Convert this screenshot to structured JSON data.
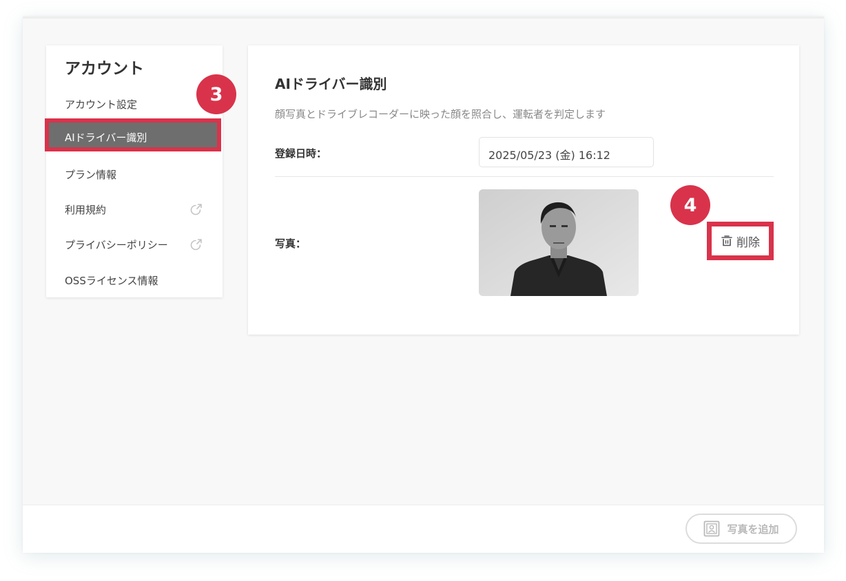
{
  "sidebar": {
    "title": "アカウント",
    "items": [
      {
        "label": "アカウント設定"
      },
      {
        "label": "AIドライバー識別"
      },
      {
        "label": "プラン情報"
      },
      {
        "label": "利用規約"
      },
      {
        "label": "プライバシーポリシー"
      },
      {
        "label": "OSSライセンス情報"
      }
    ],
    "external_icon": "external-link-icon"
  },
  "badges": {
    "sidebar_step": "3",
    "delete_step": "4"
  },
  "main": {
    "title": "AIドライバー識別",
    "description": "顔写真とドライブレコーダーに映った顔を照合し、運転者を判定します",
    "registered_label": "登録日時：",
    "registered_value": "2025/05/23 (金) 16:12",
    "photo_label": "写真：",
    "delete_label": "削除",
    "delete_icon": "trash-icon"
  },
  "footer": {
    "add_photo_label": "写真を追加",
    "add_photo_icon": "portrait-icon"
  },
  "colors": {
    "accent": "#d9334b",
    "active_item_bg": "#6e6e6e",
    "panel_bg": "#ffffff",
    "page_bg": "#f8f8f8"
  }
}
